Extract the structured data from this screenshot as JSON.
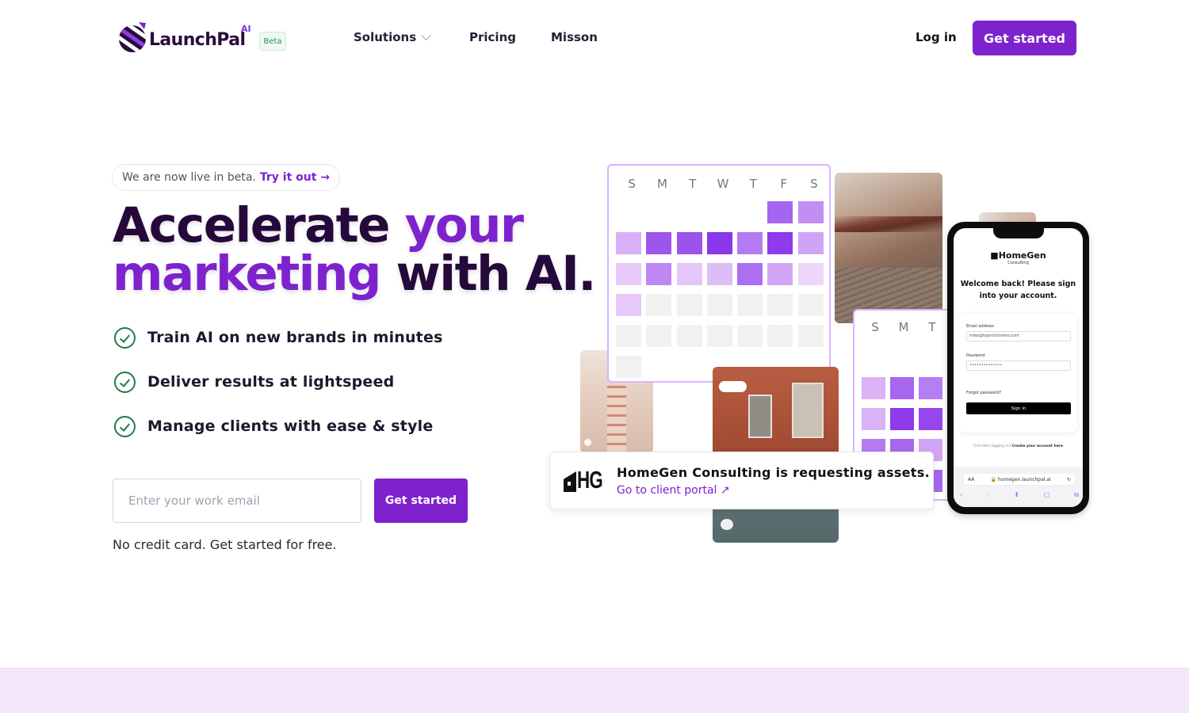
{
  "nav": {
    "brand": "LaunchPal",
    "brand_superscript": "AI",
    "beta_badge": "Beta",
    "links": [
      {
        "label": "Solutions",
        "has_dropdown": true
      },
      {
        "label": "Pricing",
        "has_dropdown": false
      },
      {
        "label": "Misson",
        "has_dropdown": false
      }
    ],
    "login_label": "Log in",
    "cta_label": "Get started"
  },
  "hero": {
    "announcement": {
      "text": "We are now live in beta.",
      "link": "Try it out →"
    },
    "headline": {
      "part1": "Accelerate ",
      "highlight1": "your",
      "highlight2": "marketing",
      "part2": " with AI."
    },
    "features": [
      "Train AI on new brands in minutes",
      "Deliver results at lightspeed",
      "Manage clients with ease & style"
    ],
    "email_placeholder": "Enter your work email",
    "email_value": "",
    "cta_label": "Get started",
    "subnote": "No credit card. Get started for free."
  },
  "calendar_main": {
    "days": [
      "S",
      "M",
      "T",
      "W",
      "T",
      "F",
      "S"
    ],
    "cells": [
      null,
      null,
      null,
      null,
      null,
      "#a565f0",
      "#c38ef2",
      "#d9b0f5",
      "#9e55ee",
      "#9c52ec",
      "#8a36ea",
      "#b47af2",
      "#8d3beb",
      "#d0a4f4",
      "#e6c9f8",
      "#c086f2",
      "#e4c6f8",
      "#dcbdf7",
      "#ae6ef1",
      "#d3a6f5",
      "#ecd7fa",
      "#e6c9f8",
      "#f1f1f1",
      "#f1f1f1",
      "#f1f1f1",
      "#f1f1f1",
      "#f1f1f1",
      "#f1f1f1",
      "#f1f1f1",
      "#f1f1f1",
      "#f1f1f1",
      "#f1f1f1",
      "#f1f1f1",
      "#f1f1f1",
      "#f1f1f1",
      "#f1f1f1"
    ]
  },
  "calendar_secondary": {
    "days": [
      "S",
      "M",
      "T"
    ],
    "cells": [
      "#dcb2f6",
      "#a866ef",
      "#b57ef2",
      "#d9b3f6",
      "#8d3beb",
      "#9646ec",
      "#b57af2",
      "#a866ef",
      "#d2a4f4",
      null,
      null,
      "#a866ef"
    ]
  },
  "toast": {
    "logo_text": "HG",
    "title": "HomeGen Consulting is requesting assets.",
    "link": "Go to client portal ↗"
  },
  "phone": {
    "brand": "HomeGen",
    "brand_sub": "Consulting",
    "welcome": "Welcome back! Please sign into your account.",
    "email_label": "Email address",
    "email_value": "mike@topnotchreno.com",
    "password_label": "Password",
    "password_value": "••••••••••••••",
    "forgot": "Forgot password?",
    "signin": "Sign in",
    "create_prefix": "First time logging in?",
    "create_link": "Create your account here",
    "url_aa": "AA",
    "url": "🔒 homegen.launchpal.ai",
    "reload_icon": "↻",
    "toolbar": [
      "‹",
      "›",
      "⬆",
      "□",
      "⧉"
    ]
  },
  "colors": {
    "brand_purple": "#7e22ce",
    "headline_dark": "#26093b",
    "check_green": "#237a4b",
    "band": "#f3e6f8"
  }
}
